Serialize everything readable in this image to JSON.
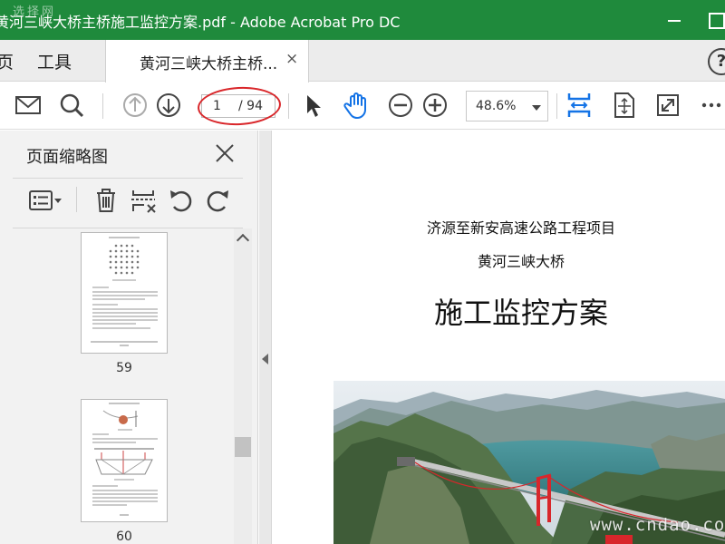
{
  "window": {
    "title": "黄河三峡大桥主桥施工监控方案.pdf - Adobe Acrobat Pro DC",
    "watermark_logo": "选择网"
  },
  "menu": {
    "home_fragment": "页",
    "tools": "工具"
  },
  "tab": {
    "label": "黄河三峡大桥主桥...",
    "close": "×"
  },
  "help": {
    "label": "?"
  },
  "toolbar": {
    "current_page": "1",
    "total_pages": "/ 94",
    "zoom": "48.6%",
    "icons": [
      "mail-icon",
      "search-icon",
      "prev-page-icon",
      "next-page-icon",
      "select-cursor-icon",
      "hand-tool-icon",
      "zoom-out-icon",
      "zoom-in-icon",
      "fit-width-icon",
      "fit-page-icon",
      "full-screen-icon",
      "more-icon"
    ],
    "accent": "#1473e6",
    "annotation_color": "#d9262a"
  },
  "sidebar": {
    "title": "页面缩略图",
    "close": "×",
    "thumbnails": [
      {
        "page": "59"
      },
      {
        "page": "60"
      }
    ]
  },
  "document": {
    "line1": "济源至新安高速公路工程项目",
    "line2": "黄河三峡大桥",
    "title": "施工监控方案"
  },
  "watermark_site": "www.cndao.com",
  "colors": {
    "titlebar": "#1f8a3c",
    "bridge": "#d8262b"
  }
}
